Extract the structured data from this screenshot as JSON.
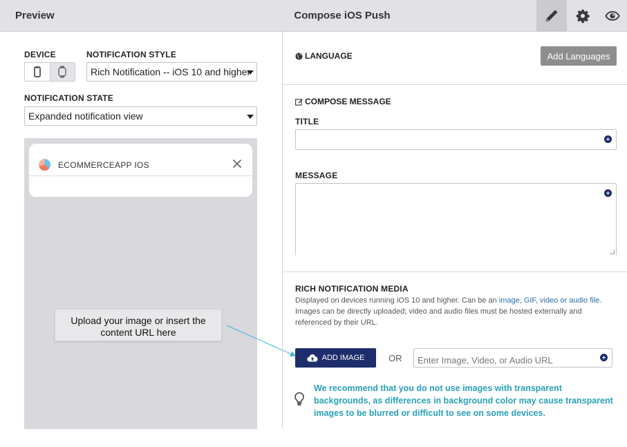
{
  "header": {
    "left_title": "Preview",
    "center_title": "Compose iOS Push",
    "actions": [
      {
        "icon": "pencil-icon",
        "active": true
      },
      {
        "icon": "gear-icon",
        "active": false
      },
      {
        "icon": "eye-icon",
        "active": false
      }
    ]
  },
  "left": {
    "device_label": "DEVICE",
    "devices": [
      "phone-icon",
      "watch-icon"
    ],
    "style_label": "NOTIFICATION STYLE",
    "style_value": "Rich Notification -- iOS 10 and higher",
    "state_label": "NOTIFICATION STATE",
    "state_value": "Expanded notification view",
    "preview": {
      "app_name": "ECOMMERCEAPP IOS"
    },
    "callout": "Upload your image or insert the content URL here"
  },
  "right": {
    "language": {
      "title": "LANGUAGE",
      "add_button": "Add Languages"
    },
    "compose": {
      "title": "COMPOSE MESSAGE",
      "title_label": "TITLE",
      "title_value": "",
      "message_label": "MESSAGE",
      "message_value": ""
    },
    "rich_media": {
      "title": "RICH NOTIFICATION MEDIA",
      "desc_prefix": "Displayed on devices running iOS 10 and higher. Can be an ",
      "desc_link": "image, GIF, video or audio file.",
      "desc_suffix": " Images can be directly uploaded; video and audio files must be hosted externally and referenced by their URL.",
      "add_image_label": "ADD IMAGE",
      "or_label": "OR",
      "url_placeholder": "Enter Image, Video, or Audio URL",
      "tip": "We recommend that you do not use images with transparent backgrounds, as differences in background color may cause transparent images to be blurred or difficult to see on some devices."
    }
  },
  "colors": {
    "navy": "#1e2d6b",
    "tip": "#2aa0b8",
    "link": "#2a6fa8",
    "topbar": "#e2e1e6"
  }
}
